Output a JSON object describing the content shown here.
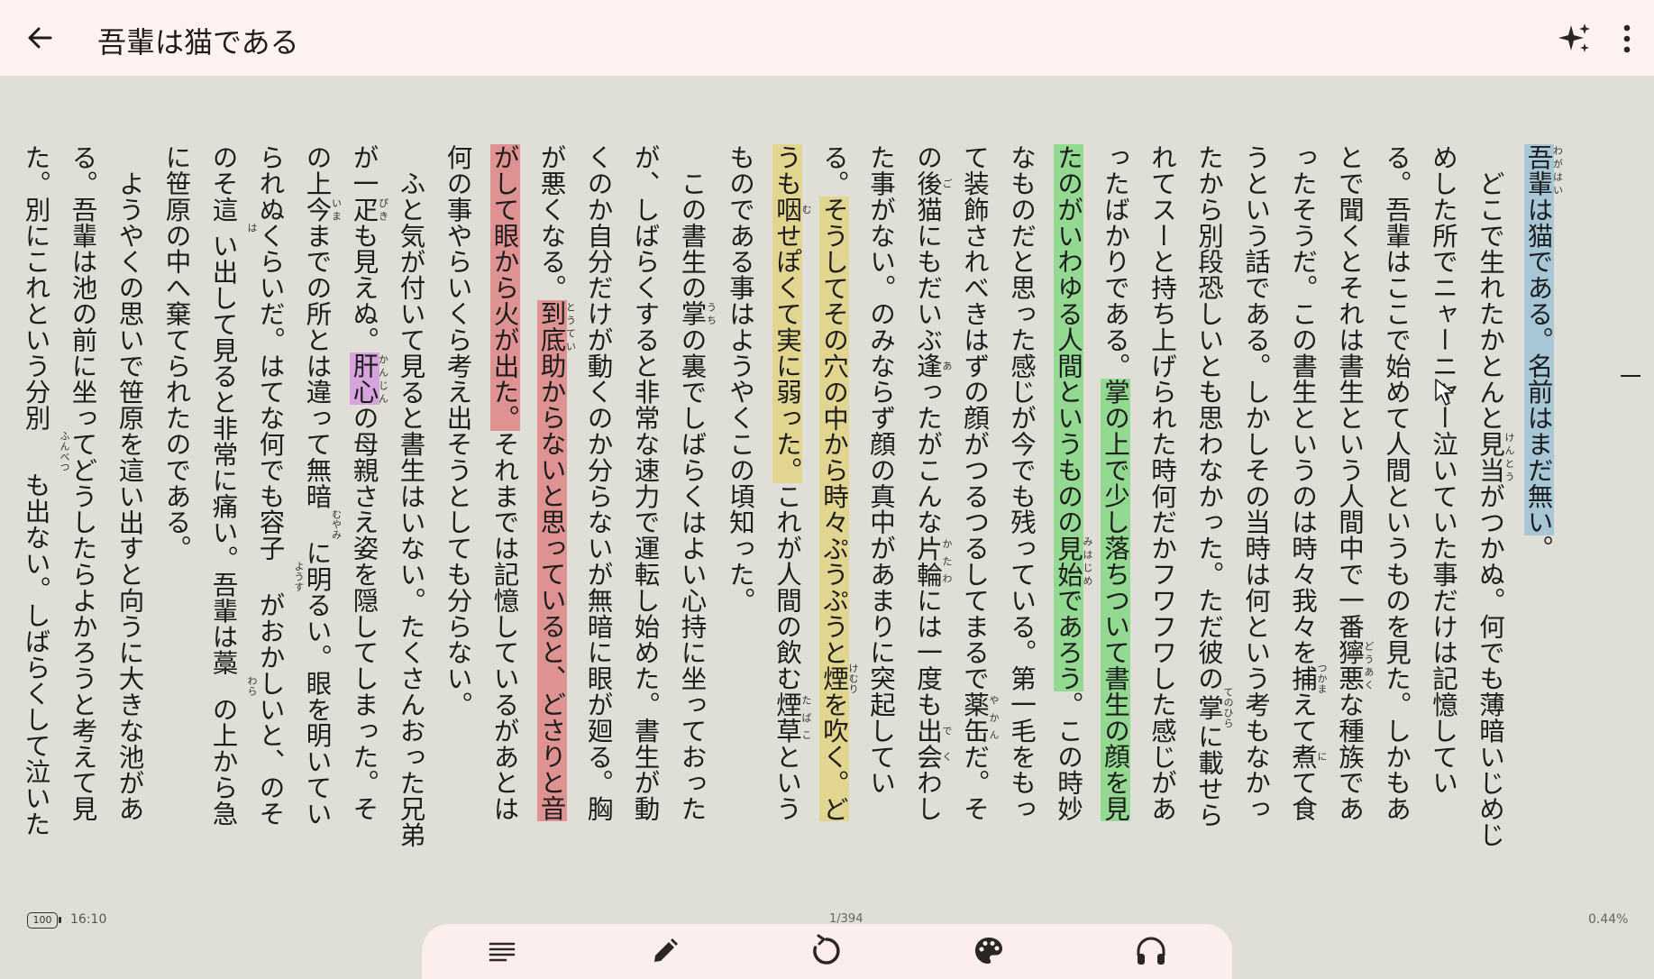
{
  "header": {
    "title": "吾輩は猫である"
  },
  "chapter_marker": "一",
  "status": {
    "battery": "100",
    "time": "16:10",
    "page": "1/394",
    "progress": "0.44%"
  },
  "icons": {
    "back": "arrow-left-icon",
    "ai": "sparkles-icon",
    "more": "more-vertical-icon",
    "toc": "list-icon",
    "annotate": "pencil-icon",
    "auto_read": "refresh-circle-icon",
    "theme": "palette-icon",
    "tts": "headphones-icon"
  },
  "highlight_colors": {
    "blue": "#a7c7d6",
    "green": "#93d992",
    "yellow": "#e2d590",
    "red": "#de9292",
    "purple": "#d7a3dd"
  },
  "text": {
    "wagahai_rb": "吾輩",
    "wagahai_rt": "わがはい",
    "p1_a": "は猫である。名前はまだ無い",
    "p1_b": "。",
    "p2_a": "どこで生れたかとんと",
    "kentou_rb": "見当",
    "kentou_rt": "けんとう",
    "p2_b": "がつかぬ。何でも薄暗いじめじめした所でニャーニャー泣いていた事だけは記憶している。吾輩はここで始めて人間というものを見た。しかもあとで聞くとそれは書生という人間中で一番",
    "douaku_rb": "獰悪",
    "douaku_rt": "どうあく",
    "p2_c": "な種族であったそうだ。この書生というのは時々我々を",
    "tsukamae_rb": "捕",
    "tsukamae_rt": "つかま",
    "p2_d": "えて",
    "ni_rb": "煮",
    "ni_rt": "に",
    "p2_e": "て食うという話である。しかしその当時は何という考もなかったから別段恐しいとも思わなかった。ただ彼の",
    "tenohira_rb": "掌",
    "tenohira_rt": "てのひら",
    "p2_f": "に載せられてスーと持ち上げられた時何だかフワフワした感じがあったばかりである。",
    "p2_g": "掌の上で少し落ちついて書生の顔を見たのがいわゆる人間というものの",
    "mihajime_rb": "見始",
    "mihajime_rt": "みはじめ",
    "p2_h": "であろう",
    "p2_i": "。この時妙なものだと思った感じが今でも残っている。第一毛をもって装飾されべきはずの顔がつるつるしてまるで",
    "yakan_rb": "薬缶",
    "yakan_rt": "やかん",
    "p2_j": "だ。その",
    "go_rb": "後",
    "go_rt": "ご",
    "p2_k": "猫にもだいぶ",
    "a_rb": "逢",
    "a_rt": "あ",
    "p2_l": "ったがこんな",
    "katawa_rb": "片輪",
    "katawa_rt": "かたわ",
    "p2_m": "には一度も",
    "deku_rb": "出会",
    "deku_rt": "でく",
    "p2_n": "わした事がない。のみならず顔の真中があまりに突起している。",
    "p2_o": "そうしてその穴の中から時々ぷうぷうと",
    "kemuri_rb": "煙",
    "kemuri_rt": "けむり",
    "p2_p": "を吹く。どうも",
    "mu_rb": "咽",
    "mu_rt": "む",
    "p2_q": "せぽくて実に弱った。",
    "p2_r": "これが人間の飲む",
    "tabako_rb": "煙草",
    "tabako_rt": "たばこ",
    "p2_s": "というものである事はようやくこの頃知った。",
    "p3_a": "この書生の",
    "uchi_rb": "掌",
    "uchi_rt": "うち",
    "p3_b": "の裏でしばらくはよい心持に坐っておったが、しばらくすると非常な速力で運転し始めた。書生が動くのか自分だけが動くのか分らないが無暗に眼が廻る。胸が悪くなる。",
    "toutei_rb": "到底",
    "toutei_rt": "とうてい",
    "p3_c": "助からないと思っていると、どさりと音がして眼から火が出た。",
    "p3_d": "それまでは記憶しているがあとは何の事やらいくら考え出そうとしても分らない。",
    "p4_a": "ふと気が付いて見ると書生はいない。たくさんおった兄弟が一",
    "biki_rb": "疋",
    "biki_rt": "ぴき",
    "p4_b": "も見えぬ。",
    "kanjin_rb": "肝心",
    "kanjin_rt": "かんじん",
    "p4_c": "の母親さえ姿を隠してしまった。その上",
    "ima_rb": "今",
    "ima_rt": "いま",
    "p4_d": "までの所とは違って無暗",
    "muyami_rt": "むやみ",
    "p4_e": "に明るい。眼を明いていられぬくらいだ。はてな何でも容子",
    "yousu_rt": "ようす",
    "p4_f": "がおかしいと、のそのそ這",
    "ha_rt": "は",
    "p4_g": "い出して見ると非常に痛い。吾輩は藁",
    "wara_rt": "わら",
    "p4_h": "の上から急に笹原の中へ棄てられたのである。",
    "p5_a": "ようやくの思いで笹原を這い出すと向うに大きな池がある。吾輩は池の前に坐ってどうしたらよかろうと考えて見た。別にこれという分別",
    "funbetsu_rt": "ふんべつ",
    "p5_b": "も出ない。しばらくして泣いたら"
  }
}
